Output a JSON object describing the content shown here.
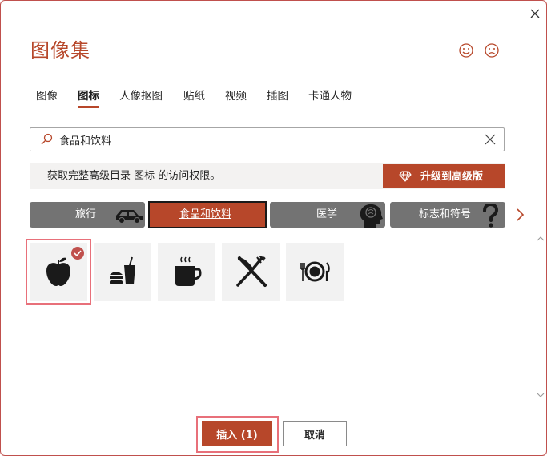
{
  "dialog": {
    "title": "图像集",
    "colors": {
      "accent": "#b7472a",
      "category_bg": "#737373",
      "banner_bg": "#f3f2f1",
      "tile_bg": "#f2f2f2"
    }
  },
  "feedback": {
    "happy_icon": "smiley-icon",
    "sad_icon": "frown-icon"
  },
  "tabs": [
    {
      "label": "图像",
      "active": false
    },
    {
      "label": "图标",
      "active": true
    },
    {
      "label": "人像抠图",
      "active": false
    },
    {
      "label": "贴纸",
      "active": false
    },
    {
      "label": "视频",
      "active": false
    },
    {
      "label": "插图",
      "active": false
    },
    {
      "label": "卡通人物",
      "active": false
    }
  ],
  "search": {
    "value": "食品和饮料"
  },
  "banner": {
    "text": "获取完整高级目录 图标 的访问权限。",
    "upgrade_label": "升级到高级版"
  },
  "categories": [
    {
      "label": "旅行",
      "icon": "car-icon",
      "selected": false
    },
    {
      "label": "食品和饮料",
      "icon": "",
      "selected": true
    },
    {
      "label": "医学",
      "icon": "brain-head-icon",
      "selected": false
    },
    {
      "label": "标志和符号",
      "icon": "question-mark-icon",
      "selected": false
    }
  ],
  "icons": [
    {
      "name": "apple-icon",
      "selected": true
    },
    {
      "name": "fast-food-icon",
      "selected": false
    },
    {
      "name": "coffee-mug-icon",
      "selected": false
    },
    {
      "name": "fork-knife-icon",
      "selected": false
    },
    {
      "name": "plate-cutlery-icon",
      "selected": false
    }
  ],
  "footer": {
    "insert_label": "插入 (1)",
    "cancel_label": "取消"
  }
}
